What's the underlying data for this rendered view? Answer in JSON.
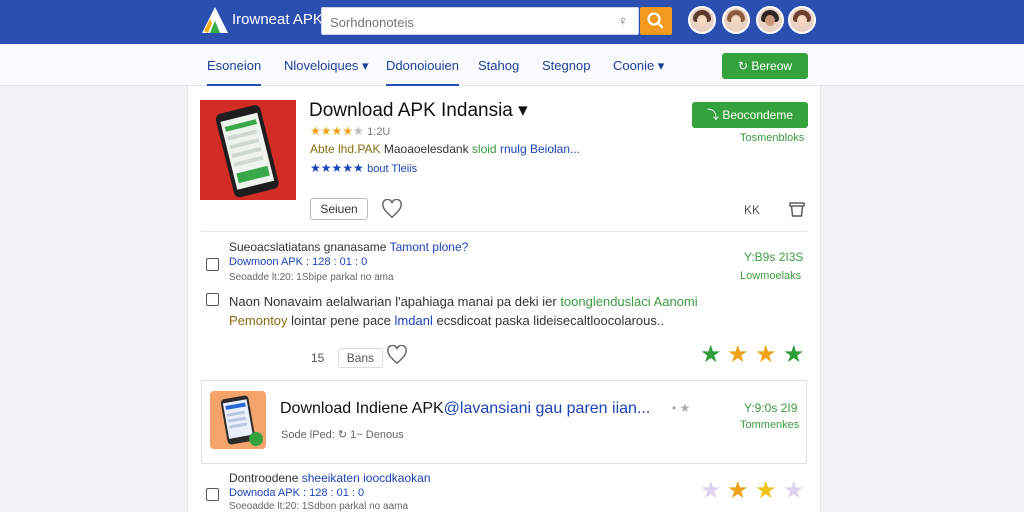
{
  "header": {
    "logo_text": "Irowneat APK",
    "search_placeholder": "Sorhdnonoteis",
    "search_clear_glyph": "♀"
  },
  "nav": {
    "items": [
      {
        "label": "Esoneion"
      },
      {
        "label": "Nloveloiques ▾"
      },
      {
        "label": "Ddonoiouien"
      },
      {
        "label": "Stahog"
      },
      {
        "label": "Stegnop"
      },
      {
        "label": "Coonie ▾"
      }
    ],
    "cta_label": "Bereow"
  },
  "hero": {
    "title": "Download APK Indansia ▾",
    "rating_count": "1:2U",
    "line1_a": "Abte lhd.PAK",
    "line1_b": "Maoaoelesdank",
    "line1_c": "sloid",
    "line1_d": "rnulg Beiolan...",
    "line2_tail": "bout Tleiis",
    "download_label": "Beocondeme",
    "download_sub": "Tosmenbloks",
    "small_button": "Seiuen",
    "right_code": "KK"
  },
  "row1": {
    "title_a": "Sueoacslatiatans gnanasame",
    "title_b": "Tamont plone?",
    "sub": "Dowmoon APK : 128 : 01 : 0",
    "meta": "Seoadde lt:20: 1Sbipe parkal no ama",
    "price": "Y:B9s 2I3S",
    "price_sub": "Lowmoelaks"
  },
  "row2": {
    "line1_a": "Naon Nonavaim aelalwarian l'apahiaga manai pa deki ier",
    "line1_b": "toonglenduslaci Aanomi",
    "line2_a": "Pemontoy",
    "line2_b": "lointar pene pace",
    "line2_c": "lmdanl",
    "line2_d": "ecsdicoat paska lideisecaltloocolarous..",
    "share_count": "15",
    "share_label": "Bans"
  },
  "card": {
    "title_a": "Download Indiene APK",
    "title_b": "@lavansiani gau paren iian...",
    "meta_a": "Sode lPed:",
    "meta_b": "1~ Denous",
    "price": "Y:9:0s 2I9",
    "price_sub": "Tommenkes"
  },
  "row3": {
    "title_a": "Dontroodene",
    "title_b": "sheeikaten ioocdkaokan",
    "sub": "Downoda APK : 128 : 01 : 0",
    "meta": "Soeoadde lt:20: 1Sdbon parkal no aama"
  },
  "colors": {
    "brand_blue": "#2a4fb0",
    "accent_green": "#35a23d",
    "search_orange": "#f29a1f",
    "star_gold": "#f0a31a",
    "star_green": "#2e9e3a"
  }
}
